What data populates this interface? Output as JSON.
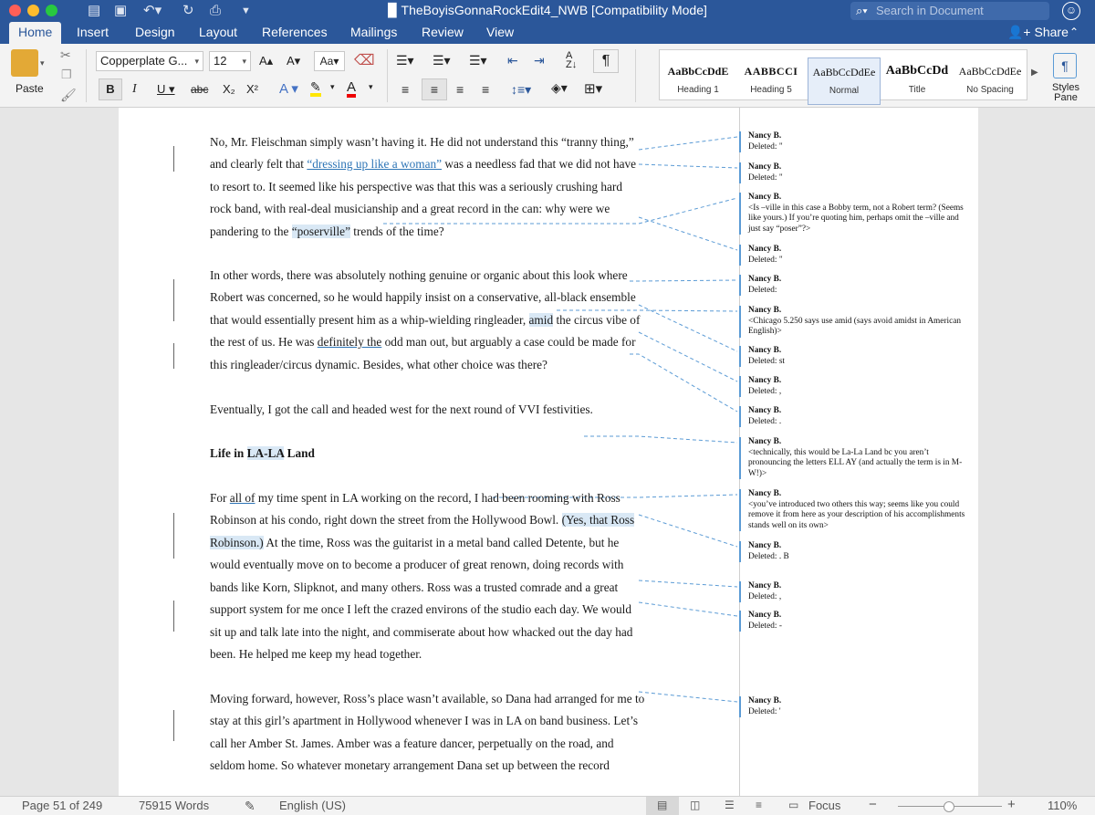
{
  "window": {
    "title": "TheBoyisGonnaRockEdit4_NWB [Compatibility Mode]",
    "search_placeholder": "Search in Document"
  },
  "ribbon_tabs": [
    "Home",
    "Insert",
    "Design",
    "Layout",
    "References",
    "Mailings",
    "Review",
    "View"
  ],
  "active_tab": "Home",
  "share_label": "Share",
  "ribbon": {
    "paste_label": "Paste",
    "font_name": "Copperplate G...",
    "font_size": "12",
    "style_gallery": [
      {
        "sample": "AaBbCcDdE",
        "name": "Heading 1"
      },
      {
        "sample": "AABBCCI",
        "name": "Heading 5"
      },
      {
        "sample": "AaBbCcDdEe",
        "name": "Normal"
      },
      {
        "sample": "AaBbCcDd",
        "name": "Title"
      },
      {
        "sample": "AaBbCcDdEe",
        "name": "No Spacing"
      }
    ],
    "selected_style": "Normal",
    "styles_pane_label": "Styles Pane"
  },
  "document": {
    "lines": [
      {
        "segments": [
          {
            "t": "No, Mr. Fleischman simply wasn’t having it. He did not understand this “tranny thing,”"
          }
        ]
      },
      {
        "segments": [
          {
            "t": "and clearly felt that "
          },
          {
            "t": "“dressing up like a woman”",
            "cls": "ins"
          },
          {
            "t": " was a needless fad that we did not have"
          }
        ]
      },
      {
        "segments": [
          {
            "t": "to resort to. It seemed like his perspective was that this was a seriously crushing hard"
          }
        ]
      },
      {
        "segments": [
          {
            "t": "rock band, with real-deal musicianship and a great record in the can: why were we"
          }
        ]
      },
      {
        "segments": [
          {
            "t": "pandering to the "
          },
          {
            "t": "“poserville”",
            "cls": "hl"
          },
          {
            "t": " trends of the time?"
          }
        ]
      },
      {
        "segments": [
          {
            "t": "In other words, there was absolutely nothing genuine or organic about this look where"
          }
        ]
      },
      {
        "segments": [
          {
            "t": "Robert was concerned, so he would happily insist on a conservative, all-black ensemble"
          }
        ]
      },
      {
        "segments": [
          {
            "t": "that would essentially present him as a whip-wielding ringleader, "
          },
          {
            "t": "amid",
            "cls": "hl"
          },
          {
            "t": " the circus vibe of"
          }
        ]
      },
      {
        "segments": [
          {
            "t": "the rest of us. He was "
          },
          {
            "t": "definitely the",
            "cls": "uline"
          },
          {
            "t": " odd man out, but arguably a case could be made for"
          }
        ]
      },
      {
        "segments": [
          {
            "t": "this ringleader/circus dynamic. Besides, what other choice was there?"
          }
        ]
      },
      {
        "segments": [
          {
            "t": "Eventually, I got the call and headed west for the next round of VVI festivities."
          }
        ]
      },
      {
        "segments": [
          {
            "t": "Life in "
          },
          {
            "t": "LA-LA",
            "cls": "hl"
          },
          {
            "t": " Land"
          }
        ],
        "bold": true
      },
      {
        "segments": [
          {
            "t": "For "
          },
          {
            "t": "all of",
            "cls": "uline"
          },
          {
            "t": " my time spent in LA working on the record, I had been rooming with Ross"
          }
        ]
      },
      {
        "segments": [
          {
            "t": "Robinson at his condo, right down the street from the Hollywood Bowl. "
          },
          {
            "t": "(Yes, that Ross",
            "cls": "hl"
          }
        ]
      },
      {
        "segments": [
          {
            "t": "Robinson.)",
            "cls": "hl"
          },
          {
            "t": " At the time, Ross was the guitarist in a metal band called Detente, but he"
          }
        ]
      },
      {
        "segments": [
          {
            "t": "would eventually move on to become a producer of great renown, doing records with"
          }
        ]
      },
      {
        "segments": [
          {
            "t": "bands like Korn, Slipknot, and many others. Ross was a trusted comrade and a great"
          }
        ]
      },
      {
        "segments": [
          {
            "t": "support system for me once I left the crazed environs of the studio each day. We would"
          }
        ]
      },
      {
        "segments": [
          {
            "t": "sit up and talk late into the night, and commiserate about how whacked out the day had"
          }
        ]
      },
      {
        "segments": [
          {
            "t": "been. He helped me keep my head together."
          }
        ]
      },
      {
        "segments": [
          {
            "t": "Moving forward, however, Ross’s place wasn’t available, so Dana had arranged for me to"
          }
        ]
      },
      {
        "segments": [
          {
            "t": "stay at this girl’s apartment in Hollywood whenever I was in LA on band business. Let’s"
          }
        ]
      },
      {
        "segments": [
          {
            "t": "call her Amber St. James. Amber was a feature dancer, perpetually on the road, and"
          }
        ]
      },
      {
        "segments": [
          {
            "t": "seldom home. So whatever monetary arrangement Dana set up between the record"
          }
        ]
      }
    ],
    "comments": [
      {
        "author": "Nancy B.",
        "text": "Deleted: \""
      },
      {
        "author": "Nancy B.",
        "text": "Deleted: \""
      },
      {
        "author": "Nancy B.",
        "text": "<Is –ville in this case a Bobby term, not a Robert term? (Seems like yours.) If you’re quoting him, perhaps omit the –ville and just say “poser”?>"
      },
      {
        "author": "Nancy B.",
        "text": "Deleted: \""
      },
      {
        "author": "Nancy B.",
        "text": "Deleted:"
      },
      {
        "author": "Nancy B.",
        "text": "<Chicago 5.250 says use amid (says avoid amidst in American English)>"
      },
      {
        "author": "Nancy B.",
        "text": "Deleted: st"
      },
      {
        "author": "Nancy B.",
        "text": "Deleted: ,"
      },
      {
        "author": "Nancy B.",
        "text": "Deleted: ."
      },
      {
        "author": "Nancy B.",
        "text": "<technically, this would be La-La Land bc you aren’t pronouncing the letters ELL AY (and actually the term is in M-W!)>"
      },
      {
        "author": "Nancy B.",
        "text": "<you’ve introduced two others this way; seems like you could remove it from here as your description of his accomplishments stands well on its own>"
      },
      {
        "author": "Nancy B.",
        "text": "Deleted: . B"
      },
      {
        "author": "Nancy B.",
        "text": "Deleted: ,"
      },
      {
        "author": "Nancy B.",
        "text": "Deleted: -"
      },
      {
        "author": "Nancy B.",
        "text": "Deleted: '"
      }
    ]
  },
  "status": {
    "page": "Page 51 of 249",
    "words": "75915 Words",
    "language": "English (US)",
    "focus_label": "Focus",
    "zoom_label": "110%",
    "zoom_level_percent": 110
  }
}
